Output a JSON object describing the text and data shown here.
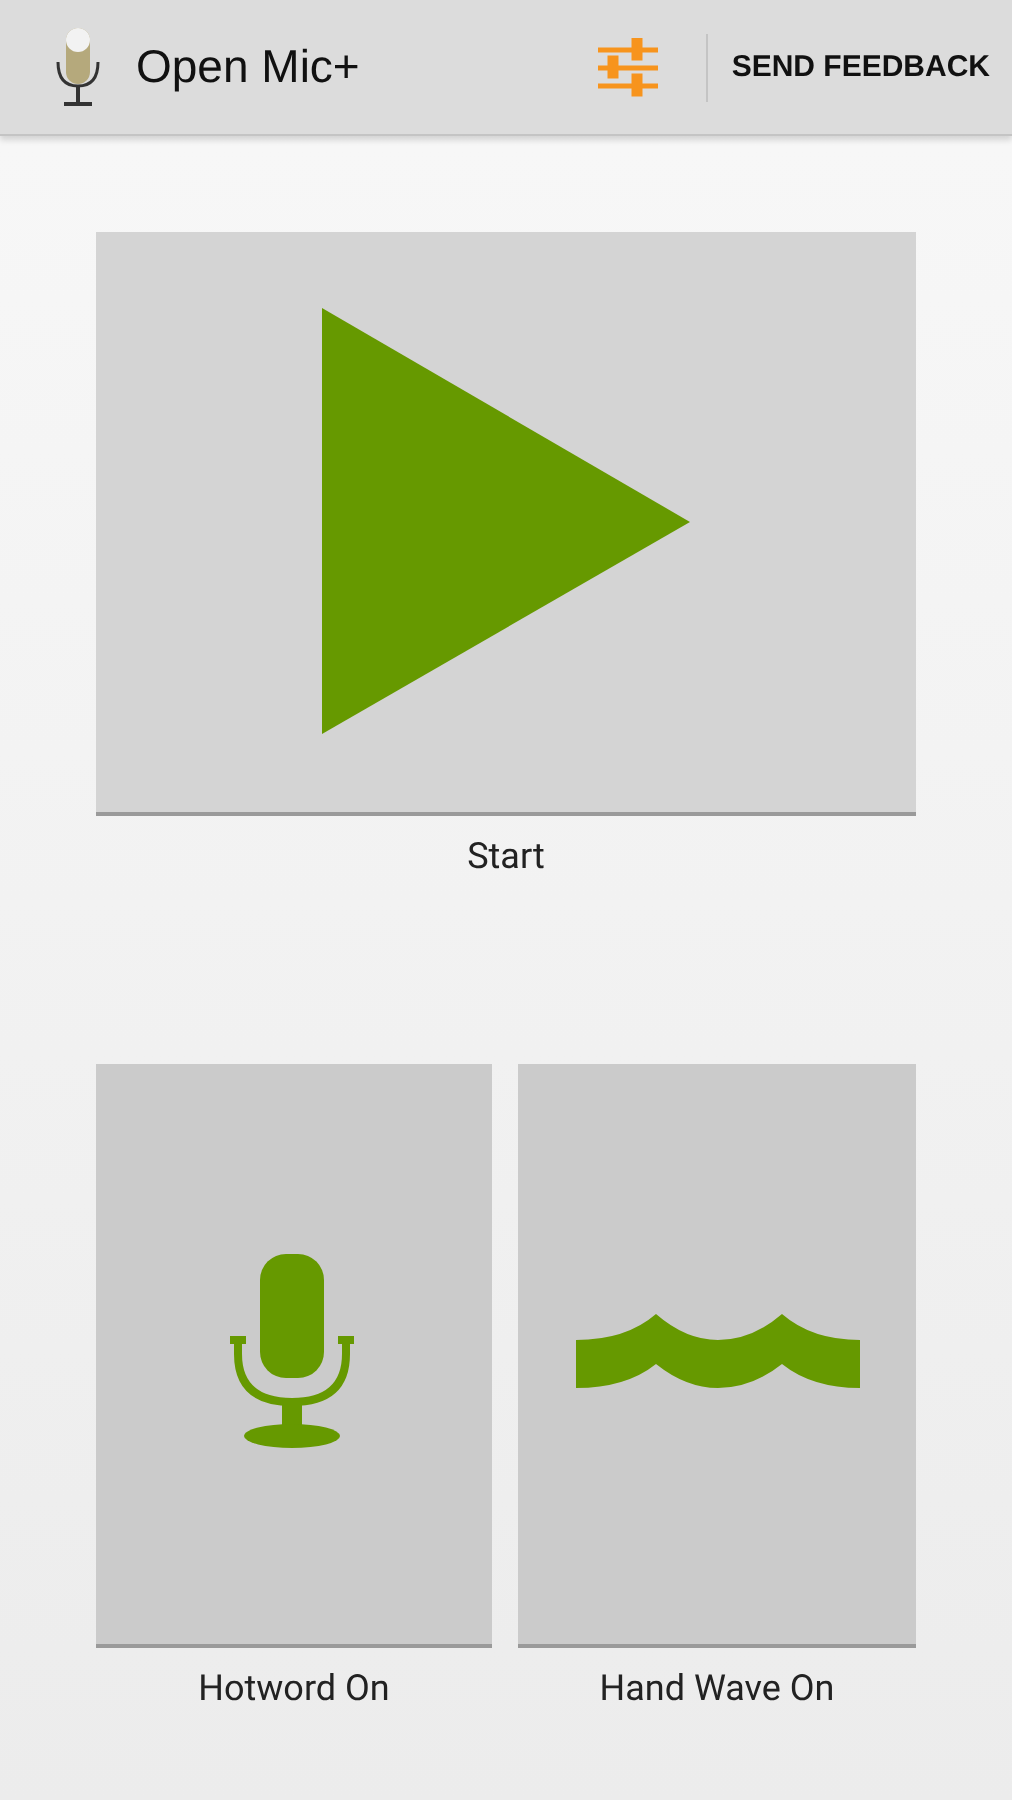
{
  "app_bar": {
    "title": "Open Mic+",
    "action": "SEND FEEDBACK"
  },
  "controls": [
    {
      "kind": "play",
      "label": "Start"
    },
    {
      "kind": "mic",
      "label": "Hotword On"
    },
    {
      "kind": "wave",
      "label": "Hand Wave On"
    }
  ]
}
